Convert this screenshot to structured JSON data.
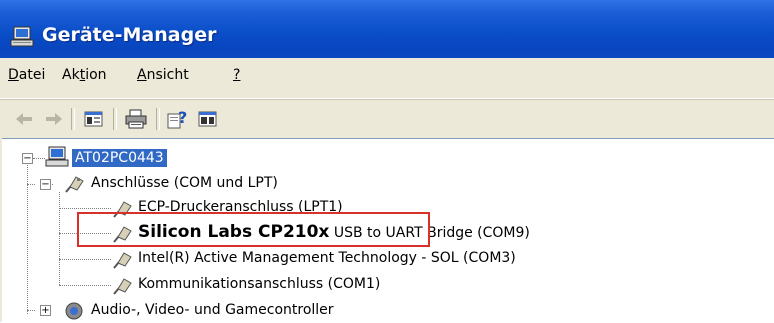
{
  "window": {
    "title": "Geräte-Manager",
    "icon": "computer-icon"
  },
  "menu": [
    {
      "label": "Datei",
      "mnemonic_index": 0
    },
    {
      "label": "Aktion",
      "mnemonic_index": 2
    },
    {
      "label": "Ansicht",
      "mnemonic_index": 0
    },
    {
      "label": "?",
      "mnemonic_index": 0
    }
  ],
  "toolbar": {
    "buttons": [
      "back-arrow-icon",
      "forward-arrow-icon",
      "properties-view-icon",
      "print-icon",
      "help-icon",
      "details-view-icon"
    ]
  },
  "tree": {
    "root": {
      "label": "AT02PC0443",
      "icon": "computer-icon",
      "expanded": true,
      "selected": true
    },
    "ports": {
      "label": "Anschlüsse (COM und LPT)",
      "icon": "port-connector-icon",
      "expanded": true,
      "children": [
        {
          "label": "ECP-Druckeranschluss (LPT1)"
        },
        {
          "label_bold": "Silicon Labs CP210x",
          "label_rest": "USB to UART Bridge (COM9)",
          "highlighted": true
        },
        {
          "label": "Intel(R) Active Management Technology - SOL (COM3)"
        },
        {
          "label": "Kommunikationsanschluss (COM1)"
        }
      ]
    },
    "audio": {
      "label": "Audio-, Video- und Gamecontroller",
      "icon": "speaker-icon",
      "expanded": false
    }
  },
  "colors": {
    "titlebar": "#0a4ec9",
    "selection": "#316ac5",
    "highlight_box": "#d9302c"
  }
}
